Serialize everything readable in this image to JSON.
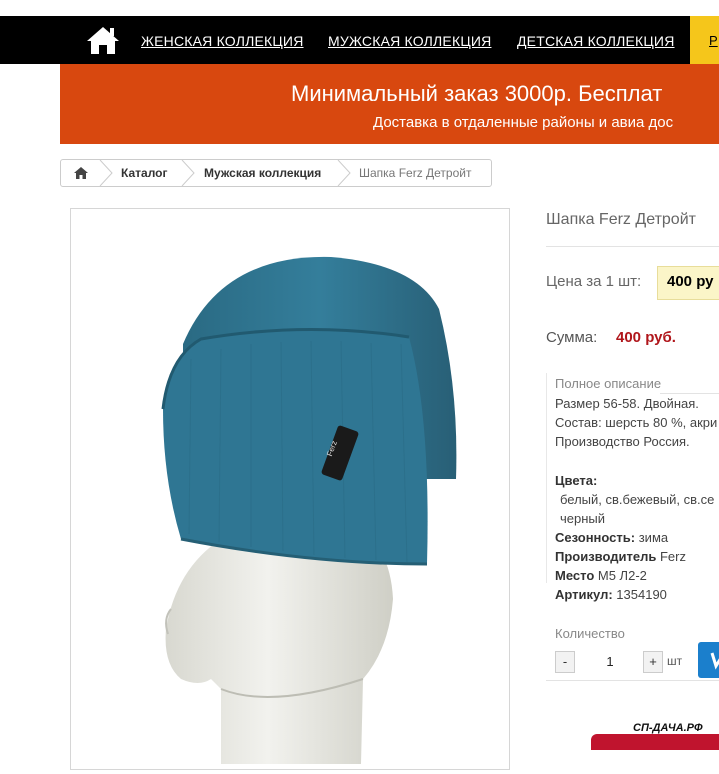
{
  "nav": {
    "links": [
      "ЖЕНСКАЯ КОЛЛЕКЦИЯ",
      "МУЖСКАЯ КОЛЛЕКЦИЯ",
      "ДЕТСКАЯ КОЛЛЕКЦИЯ"
    ],
    "partial_link": "Р"
  },
  "banner": {
    "line1": "Минимальный заказ 3000р. Бесплат",
    "line2": "Доставка в отдаленные районы и авиа дос"
  },
  "breadcrumb": [
    "Каталог",
    "Мужская коллекция",
    "Шапка Ferz Детройт"
  ],
  "product": {
    "title": "Шапка Ferz Детройт",
    "price_label": "Цена за 1 шт:",
    "price": "400 ру",
    "sum_label": "Сумма:",
    "sum": "400 руб.",
    "description_title": "Полное описание",
    "description_lines": [
      "Размер 56-58. Двойная.",
      "Состав: шерсть 80 %, акри",
      "Производство Россия."
    ],
    "colors_label": "Цвета:",
    "colors_lines": [
      "белый, св.бежевый, св.се",
      "черный"
    ],
    "season_label": "Сезонность:",
    "season": "зима",
    "maker_label": "Производитель",
    "maker": "Ferz",
    "place_label": "Место",
    "place": "М5 Л2-2",
    "article_label": "Артикул:",
    "article": "1354190",
    "hat_label": "Ferz",
    "quantity_label": "Количество",
    "quantity": "1",
    "minus": "-",
    "plus": "+",
    "unit": "шт"
  },
  "watermark": "СП-ДАЧА.РФ",
  "colors": {
    "nav_bg": "#000000",
    "banner": "#d8480f",
    "price_bg": "#fbf5c8",
    "sum_color": "#b0161b",
    "hat": "#2e7591",
    "cart": "#1b7fcc"
  }
}
